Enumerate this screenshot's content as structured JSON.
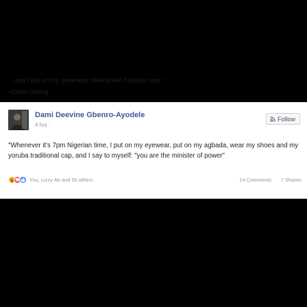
{
  "post": {
    "author": "Dami Deevine Gbenro-Ayodele",
    "time": "4 hrs ·",
    "follow_label": "Follow",
    "body": "\"Whenever it's 7pm Nigerian time, I put on my eyewear, put on my agbada, wear my shoes and my yoruba traditional cap, and I say to myself: \"you are the minister of power\"",
    "line2": "..and I put on my generator; feeling like Fashola now.\"",
    "signature": "~Ekom Obong"
  },
  "footer": {
    "likers": "You, Lizzy Ab and 50 others",
    "comments": "14 Comments",
    "shares": "7 Shares"
  },
  "icons": {
    "avatar": "profile-photo",
    "follow": "rss-icon",
    "reactions": [
      "wow-reaction-icon",
      "love-reaction-icon",
      "like-reaction-icon"
    ]
  },
  "colors": {
    "background": "#000000",
    "card": "#ffffff",
    "author_link": "#3b5998",
    "meta_text": "#9197a3",
    "body_text": "#1d2129"
  }
}
